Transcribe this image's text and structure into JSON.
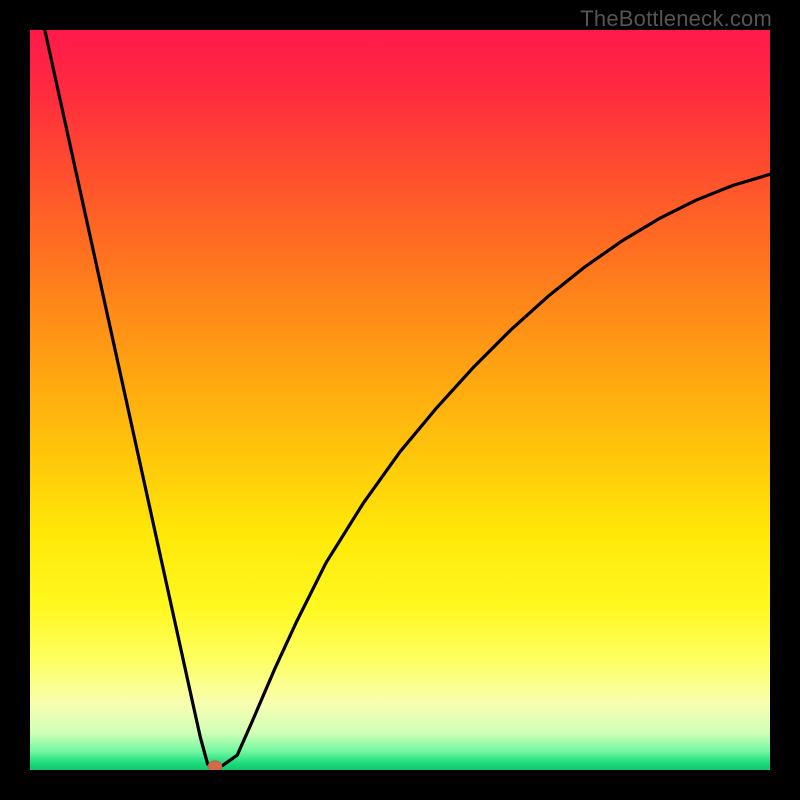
{
  "watermark": "TheBottleneck.com",
  "chart_data": {
    "type": "line",
    "title": "",
    "xlabel": "",
    "ylabel": "",
    "xlim": [
      0,
      100
    ],
    "ylim": [
      0,
      100
    ],
    "grid": false,
    "legend": false,
    "series": [
      {
        "name": "bottleneck-curve",
        "color": "#000000",
        "x": [
          2,
          4,
          6,
          8,
          10,
          12,
          14,
          16,
          18,
          20,
          22,
          23,
          24,
          25,
          26,
          28,
          30,
          33,
          36,
          40,
          45,
          50,
          55,
          60,
          65,
          70,
          75,
          80,
          85,
          90,
          95,
          100
        ],
        "y": [
          100,
          90.9,
          81.8,
          72.7,
          63.6,
          54.5,
          45.4,
          36.3,
          27.2,
          18.1,
          9.0,
          4.5,
          0.8,
          0.5,
          0.6,
          2.0,
          6.5,
          13.5,
          20.0,
          28.0,
          36.0,
          43.0,
          49.0,
          54.5,
          59.5,
          64.0,
          68.0,
          71.5,
          74.5,
          77.0,
          79.0,
          80.5
        ]
      }
    ],
    "marker": {
      "name": "optimal-point",
      "x": 25,
      "y": 0.5,
      "color": "#d46a4a"
    }
  }
}
